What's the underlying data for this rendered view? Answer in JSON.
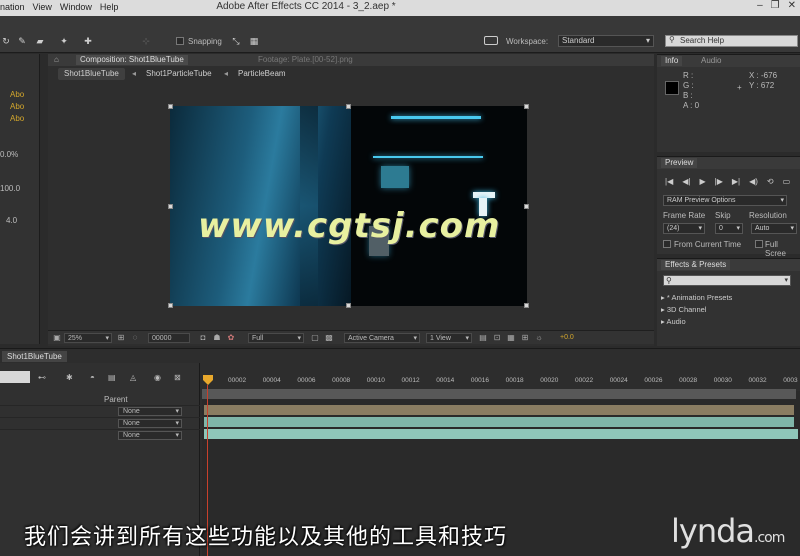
{
  "window": {
    "title": "Adobe After Effects CC 2014 - 3_2.aep *",
    "menu": [
      "nation",
      "View",
      "Window",
      "Help"
    ],
    "controls": [
      "–",
      "❐",
      "✕"
    ]
  },
  "toolbar": {
    "snapping_label": "Snapping",
    "workspace_label": "Workspace:",
    "workspace_value": "Standard",
    "search_placeholder": "Search Help"
  },
  "left_panel": {
    "labels": [
      "Abo",
      "Abo",
      "Abo"
    ],
    "values": [
      "0.0%",
      "100.0",
      "4.0"
    ]
  },
  "composition": {
    "tabs": [
      {
        "label": "Composition: Shot1BlueTube",
        "active": true
      },
      {
        "label": "Footage: Plate.[00-52].png",
        "active": false
      }
    ],
    "breadcrumbs": [
      "Shot1BlueTube",
      "Shot1ParticleTube",
      "ParticleBeam"
    ],
    "watermark": "www.cgtsj.com",
    "footer": {
      "zoom": "25%",
      "timecode": "00000",
      "resolution": "Full",
      "camera": "Active Camera",
      "views": "1 View",
      "exposure": "+0.0"
    }
  },
  "info": {
    "tabs": [
      "Info",
      "Audio"
    ],
    "channels": [
      "R :",
      "G :",
      "B :",
      "A : 0"
    ],
    "x": "X : -676",
    "y": "Y : 672",
    "swatch_color": "#000000"
  },
  "preview": {
    "tab": "Preview",
    "buttons": [
      "|◀",
      "◀|",
      "▶",
      "|▶",
      "▶|",
      "◀)",
      "⟲",
      "▭"
    ],
    "ram_options": "RAM Preview Options",
    "frame_rate_label": "Frame Rate",
    "skip_label": "Skip",
    "resolution_label": "Resolution",
    "frame_rate_value": "(24)",
    "skip_value": "0",
    "resolution_value": "Auto",
    "from_current": "From Current Time",
    "full_screen": "Full Scree"
  },
  "effects": {
    "tab": "Effects & Presets",
    "search_placeholder": "",
    "items": [
      "* Animation Presets",
      "3D Channel",
      "Audio"
    ]
  },
  "timeline": {
    "tab": "Shot1BlueTube",
    "parent_header": "Parent",
    "ticks": [
      "00002",
      "00004",
      "00006",
      "00008",
      "00010",
      "00012",
      "00014",
      "00016",
      "00018",
      "00020",
      "00022",
      "00024",
      "00026",
      "00028",
      "00030",
      "00032",
      "0003"
    ],
    "layers": [
      {
        "parent": "None",
        "color": "#8a7d62"
      },
      {
        "parent": "None",
        "color": "#7fb6a9"
      },
      {
        "parent": "None",
        "color": "#8fc7b9"
      }
    ]
  },
  "overlay": {
    "subtitle": "我们会讲到所有这些功能以及其他的工具和技巧",
    "brand": "lynda",
    "brand_suffix": ".com"
  }
}
